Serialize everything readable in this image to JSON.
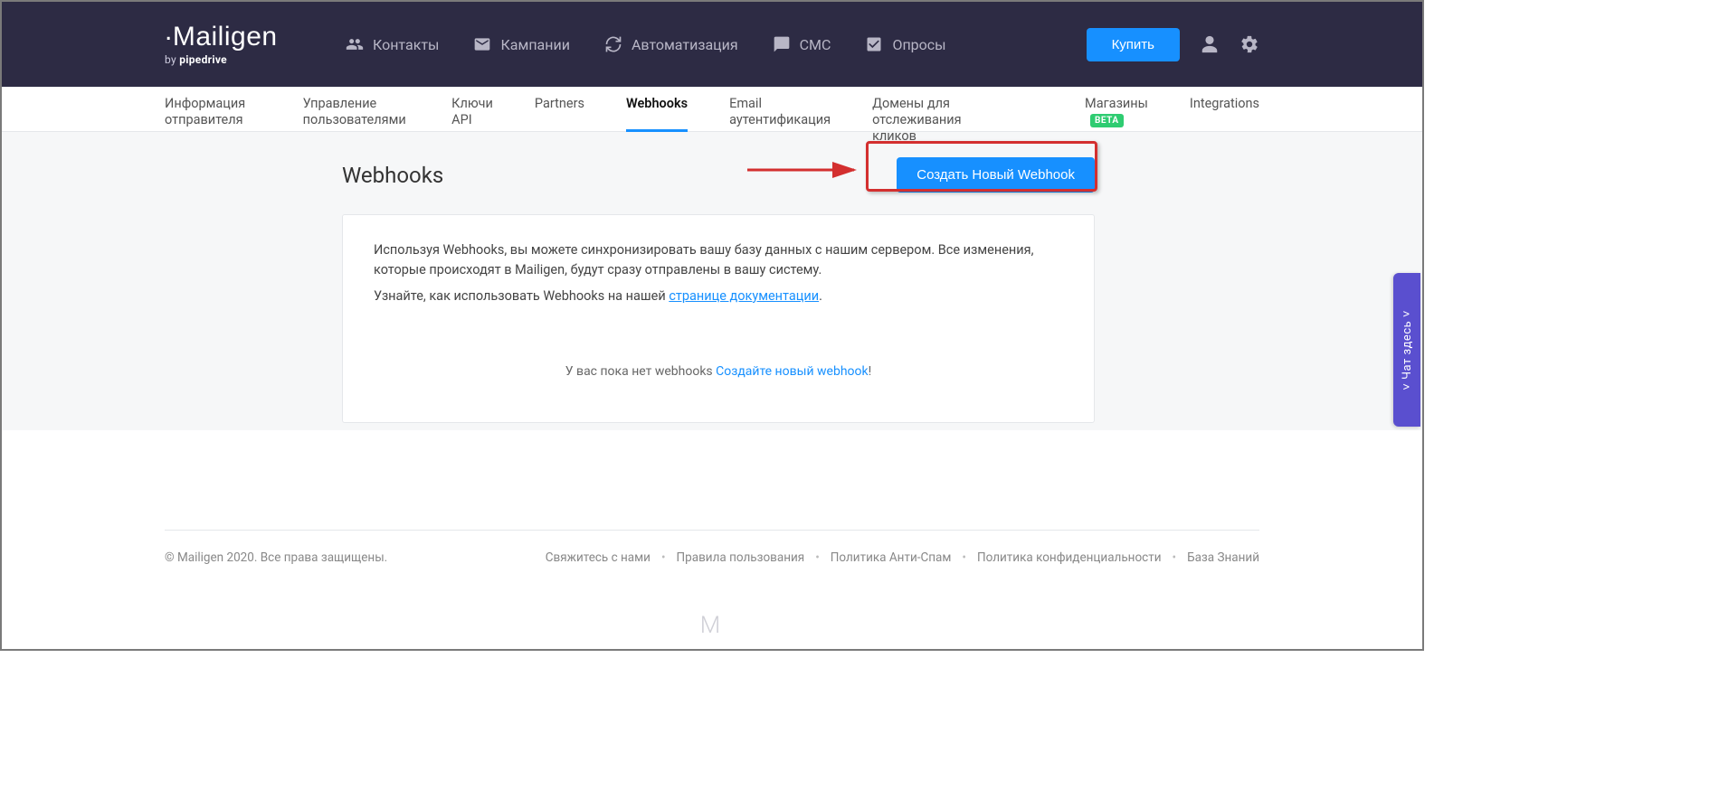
{
  "logo": {
    "main": "Mailigen",
    "sub_prefix": "by ",
    "sub_brand": "pipedrive"
  },
  "topnav": [
    {
      "label": "Контакты",
      "icon": "contacts-icon"
    },
    {
      "label": "Кампании",
      "icon": "mail-icon"
    },
    {
      "label": "Автоматизация",
      "icon": "automation-icon"
    },
    {
      "label": "СМС",
      "icon": "sms-icon"
    },
    {
      "label": "Опросы",
      "icon": "survey-icon"
    }
  ],
  "top_actions": {
    "buy_label": "Купить"
  },
  "subnav": {
    "tabs": [
      {
        "label": "Информация отправителя"
      },
      {
        "label": "Управление пользователями"
      },
      {
        "label": "Ключи API"
      },
      {
        "label": "Partners"
      },
      {
        "label": "Webhooks",
        "active": true
      },
      {
        "label": "Email аутентификация"
      },
      {
        "label": "Домены для отслеживания кликов"
      }
    ],
    "right_tabs": [
      {
        "label": "Магазины",
        "badge": "BETA"
      },
      {
        "label": "Integrations"
      }
    ]
  },
  "page": {
    "title": "Webhooks",
    "create_button": "Создать Новый Webhook",
    "description_line1": "Используя Webhooks, вы можете синхронизировать вашу базу данных с нашим сервером. Все изменения, которые происходят в Mailigen, будут сразу отправлены в вашу систему.",
    "description_line2_prefix": "Узнайте, как использовать Webhooks на нашей ",
    "description_line2_link": "странице документации",
    "description_line2_suffix": ".",
    "empty_prefix": "У вас пока нет webhooks ",
    "empty_link": "Создайте новый webhook",
    "empty_suffix": "!"
  },
  "footer": {
    "copyright": "© Mailigen 2020. Все права защищены.",
    "links": [
      "Свяжитесь с нами",
      "Правила пользования",
      "Политика Анти-Спам",
      "Политика конфиденциальности",
      "База Знаний"
    ]
  },
  "chat_tab": "˅  Чат здесь  ˅"
}
